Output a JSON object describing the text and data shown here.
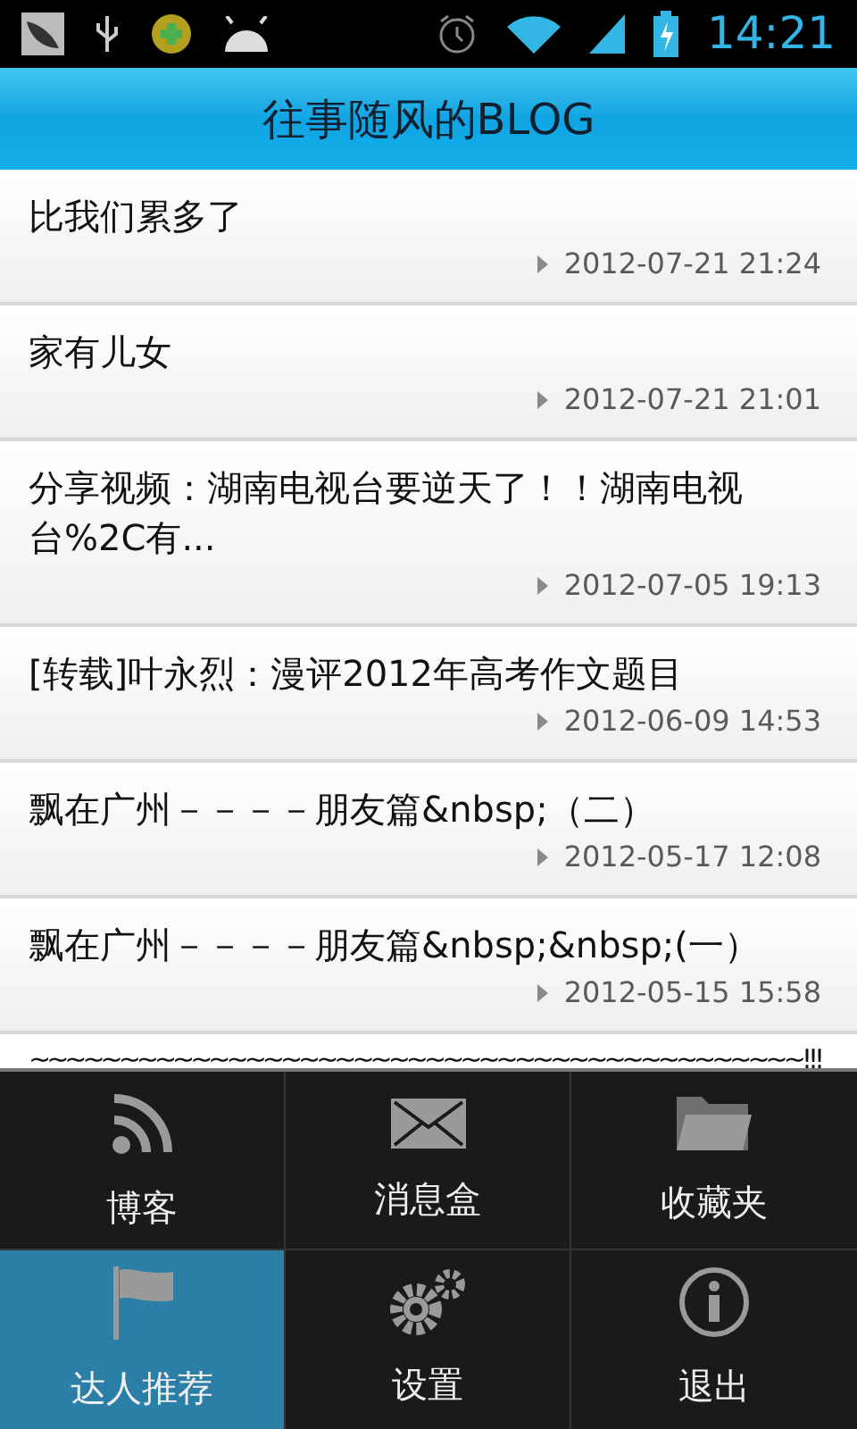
{
  "status_bar": {
    "time": "14:21"
  },
  "title": "往事随风的BLOG",
  "posts": [
    {
      "title": "比我们累多了",
      "date": "2012-07-21 21:24"
    },
    {
      "title": "家有儿女",
      "date": "2012-07-21 21:01"
    },
    {
      "title": "分享视频：湖南电视台要逆天了！！湖南电视台%2C有...",
      "date": "2012-07-05 19:13"
    },
    {
      "title": "[转载]叶永烈：漫评2012年高考作文题目",
      "date": "2012-06-09 14:53"
    },
    {
      "title": "飘在广州－－－－朋友篇&nbsp;（二）",
      "date": "2012-05-17 12:08"
    },
    {
      "title": "飘在广州－－－－朋友篇&nbsp;&nbsp;(一）",
      "date": "2012-05-15 15:58"
    }
  ],
  "partial_post": {
    "title": "~~~~~~~~~~~~~~~~~~~~~~~~~~~~~~~~~~~~~~~~~~~!!!"
  },
  "menu": [
    {
      "label": "博客",
      "selected": false
    },
    {
      "label": "消息盒",
      "selected": false
    },
    {
      "label": "收藏夹",
      "selected": false
    },
    {
      "label": "达人推荐",
      "selected": true
    },
    {
      "label": "设置",
      "selected": false
    },
    {
      "label": "退出",
      "selected": false
    }
  ]
}
